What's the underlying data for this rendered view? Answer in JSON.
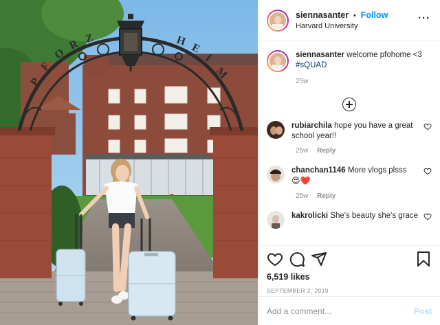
{
  "header": {
    "username": "siennasanter",
    "separator": "•",
    "follow_label": "Follow",
    "location": "Harvard University",
    "more_label": "···"
  },
  "photo": {
    "arch_letters": [
      "P",
      "F",
      "O",
      "R",
      "Z",
      "H",
      "E",
      "I",
      "M"
    ]
  },
  "caption": {
    "username": "siennasanter",
    "text": "welcome pfohome <3",
    "hashtag": "#sQUAD",
    "time": "25w"
  },
  "comments": [
    {
      "username": "rubiarchila",
      "text": "hope you have a great school year!!",
      "time": "25w",
      "reply_label": "Reply",
      "emoji": ""
    },
    {
      "username": "chanchan1146",
      "text": "More vlogs plsss",
      "time": "25w",
      "reply_label": "Reply",
      "emoji": "😍❤️"
    },
    {
      "username": "kakrolicki",
      "text": "She's beauty she's grace",
      "time": "",
      "reply_label": "",
      "emoji": ""
    }
  ],
  "post": {
    "likes": "6,519 likes",
    "date": "SEPTEMBER 2, 2019"
  },
  "add_comment": {
    "placeholder": "Add a comment...",
    "post_label": "Post"
  },
  "icons": {
    "like": "heart-icon",
    "comment": "comment-icon",
    "share": "share-icon",
    "save": "bookmark-icon",
    "load_more": "plus-circle-icon"
  },
  "colors": {
    "accent": "#0095f6",
    "hashtag": "#00376b",
    "muted": "#8e8e8e",
    "post_disabled": "#b2dffc"
  }
}
